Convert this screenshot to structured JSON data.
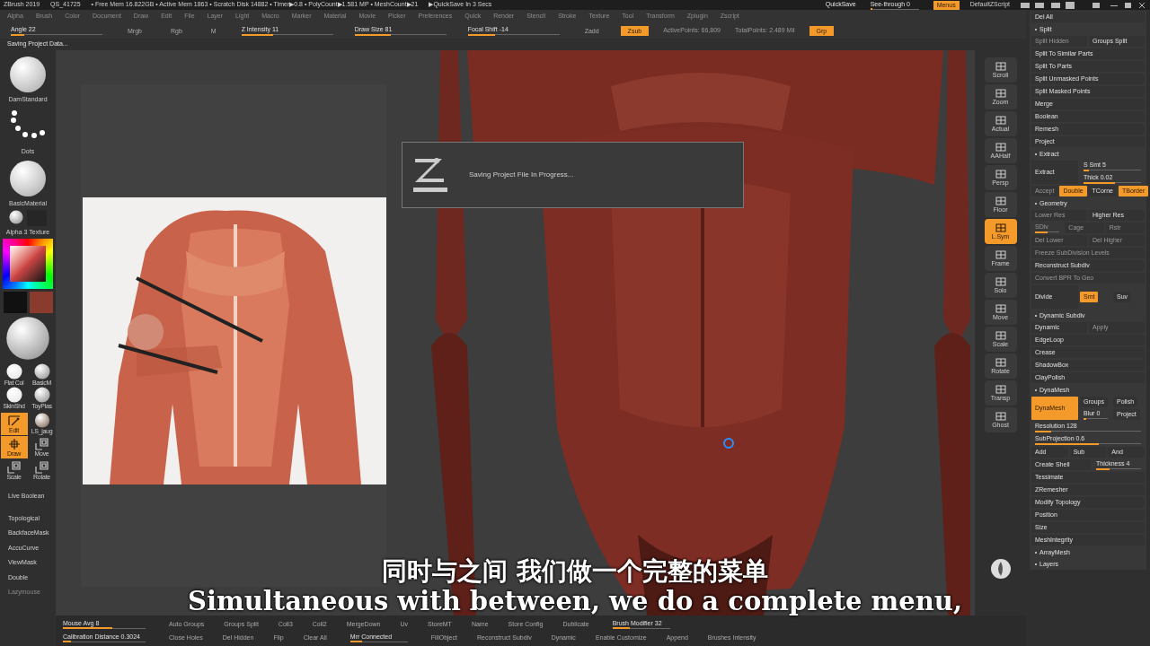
{
  "title_bar": {
    "app": "ZBrush 2019",
    "file": "QS_41725",
    "stats": "• Free Mem 16.822GB • Active Mem 1863 • Scratch Disk 14882 • Timer▶0.8 • PolyCount▶1.581 MP • MeshCount▶21",
    "quicksave_timer": "▶QuickSave In 3 Secs",
    "quicksave": "QuickSave",
    "see_through": {
      "label": "See-through  0",
      "level": 0.05
    },
    "menus": {
      "label": "Menus",
      "selected": true
    },
    "script": "DefaultZScript"
  },
  "menu_bar": [
    "Alpha",
    "Brush",
    "Color",
    "Document",
    "Draw",
    "Edit",
    "File",
    "Layer",
    "Light",
    "Macro",
    "Marker",
    "Material",
    "Movie",
    "Picker",
    "Preferences",
    "Quick",
    "Render",
    "Stencil",
    "Stroke",
    "Texture",
    "Tool",
    "Transform",
    "Zplugin",
    "Zscript"
  ],
  "toolbar": [
    {
      "kind": "slider",
      "label": "Angle 22",
      "level": 0.15
    },
    {
      "kind": "button",
      "label": "Mrgb",
      "highlighted": false
    },
    {
      "kind": "button",
      "label": "Rgb",
      "highlighted": false
    },
    {
      "kind": "button",
      "label": "M",
      "highlighted": false
    },
    {
      "kind": "slider",
      "label": "Z Intensity 11",
      "level": 0.35
    },
    {
      "kind": "slider",
      "label": "Draw Size 81",
      "level": 0.4
    },
    {
      "kind": "slider",
      "label": "Focal Shift -14",
      "level": 0.3
    },
    {
      "kind": "button",
      "label": "Zadd",
      "highlighted": false
    },
    {
      "kind": "button",
      "label": "Zsub",
      "highlighted": true
    },
    {
      "kind": "text",
      "label": "ActivePoints: 66,809"
    },
    {
      "kind": "text",
      "label": "TotalPoints: 2.489 Mil"
    },
    {
      "kind": "button",
      "label": "Grp",
      "highlighted": true
    }
  ],
  "status": "Saving Project Data...",
  "left_shelf": {
    "thumbnails": [
      {
        "kind": "sphere",
        "label": "DamStandard"
      },
      {
        "kind": "dots",
        "label": "Dots"
      },
      {
        "kind": "sphere",
        "label": "BasicMaterial"
      }
    ],
    "alpha_texture": "Alpha 3 Texture",
    "materials": [
      {
        "kind": "flat",
        "label": "Flat Col"
      },
      {
        "kind": "matte",
        "label": "BasicM"
      },
      {
        "kind": "flat",
        "label": "SkinShd"
      },
      {
        "kind": "matte",
        "label": "ToyPlas"
      }
    ],
    "tools": [
      {
        "kind": "edit",
        "label": "Edit",
        "selected": true
      },
      {
        "kind": "mesh",
        "label": "LS_jaug",
        "selected": false
      },
      {
        "kind": "draw",
        "label": "Draw",
        "selected": true
      },
      {
        "kind": "move",
        "label": "Move",
        "selected": false
      },
      {
        "kind": "move",
        "label": "Scale",
        "selected": false
      },
      {
        "kind": "rotate",
        "label": "Rotate",
        "selected": false
      }
    ],
    "buttons": [
      {
        "label": "Live Boolean",
        "disabled": false
      },
      {
        "label": "Topological",
        "disabled": false
      },
      {
        "label": "BackfaceMask",
        "disabled": false
      },
      {
        "label": "AccuCurve",
        "disabled": false
      },
      {
        "label": "ViewMask",
        "disabled": false
      },
      {
        "label": "Double",
        "disabled": false
      },
      {
        "label": "Lazymouse",
        "disabled": true
      }
    ]
  },
  "dialog": {
    "message": "Saving Project File In Progress..."
  },
  "subtitles": {
    "chinese": "同时与之间 我们做一个完整的菜单",
    "english": "Simultaneous with between, we do a complete menu,"
  },
  "right_toolbar": [
    {
      "label": "Scroll",
      "selected": false
    },
    {
      "label": "Zoom",
      "selected": false
    },
    {
      "label": "Actual",
      "selected": false
    },
    {
      "label": "AAHalf",
      "selected": false
    },
    {
      "label": "Persp",
      "selected": false
    },
    {
      "label": "Floor",
      "selected": false
    },
    {
      "label": "L.Sym",
      "selected": true
    },
    {
      "label": "Frame",
      "selected": false
    },
    {
      "label": "Solo",
      "selected": false
    },
    {
      "label": "Move",
      "selected": false
    },
    {
      "label": "Scale",
      "selected": false
    },
    {
      "label": "Rotate",
      "selected": false
    },
    {
      "label": "Transp",
      "selected": false
    },
    {
      "label": "Ghost",
      "selected": false
    }
  ],
  "tool_panel": [
    {
      "kind": "row",
      "cells": [
        {
          "kind": "button",
          "label": "Del All",
          "highlighted": false,
          "disabled": false
        }
      ]
    },
    {
      "kind": "section",
      "label": "Split"
    },
    {
      "kind": "row",
      "cells": [
        {
          "kind": "button",
          "label": "Split Hidden",
          "highlighted": false,
          "disabled": true
        },
        {
          "kind": "button",
          "label": "Groups Split",
          "highlighted": false,
          "disabled": false
        }
      ]
    },
    {
      "kind": "row",
      "cells": [
        {
          "kind": "button",
          "label": "Split To Similar Parts",
          "highlighted": false,
          "disabled": false
        }
      ]
    },
    {
      "kind": "row",
      "cells": [
        {
          "kind": "button",
          "label": "Split To Parts",
          "highlighted": false,
          "disabled": false
        }
      ]
    },
    {
      "kind": "row",
      "cells": [
        {
          "kind": "button",
          "label": "Split Unmasked Points",
          "highlighted": false,
          "disabled": false
        }
      ]
    },
    {
      "kind": "row",
      "cells": [
        {
          "kind": "button",
          "label": "Split Masked Points",
          "highlighted": false,
          "disabled": false
        }
      ]
    },
    {
      "kind": "row",
      "cells": [
        {
          "kind": "button",
          "label": "Merge",
          "highlighted": false,
          "disabled": false
        }
      ]
    },
    {
      "kind": "row",
      "cells": [
        {
          "kind": "button",
          "label": "Boolean",
          "highlighted": false,
          "disabled": false
        }
      ]
    },
    {
      "kind": "row",
      "cells": [
        {
          "kind": "button",
          "label": "Remesh",
          "highlighted": false,
          "disabled": false
        }
      ]
    },
    {
      "kind": "row",
      "cells": [
        {
          "kind": "button",
          "label": "Project",
          "highlighted": false,
          "disabled": false
        }
      ]
    },
    {
      "kind": "section",
      "label": "Extract"
    },
    {
      "kind": "block",
      "main": {
        "kind": "button",
        "label": "Extract",
        "highlighted": false,
        "disabled": false
      },
      "side": [
        {
          "kind": "slider",
          "label": "S Smt 5",
          "level": 0.1,
          "disabled": false
        },
        {
          "kind": "slider",
          "label": "Thick 0.02",
          "level": 0.55,
          "disabled": false
        }
      ]
    },
    {
      "kind": "row",
      "cells": [
        {
          "kind": "button",
          "label": "Accept",
          "highlighted": false,
          "disabled": true
        },
        {
          "kind": "button",
          "label": "Double",
          "highlighted": true,
          "disabled": false
        },
        {
          "kind": "button",
          "label": "TCorne",
          "highlighted": false,
          "disabled": false
        },
        {
          "kind": "button",
          "label": "TBorder",
          "highlighted": true,
          "disabled": false
        }
      ]
    },
    {
      "kind": "section",
      "label": "Geometry"
    },
    {
      "kind": "row",
      "cells": [
        {
          "kind": "button",
          "label": "Lower Res",
          "highlighted": false,
          "disabled": true
        },
        {
          "kind": "button",
          "label": "Higher Res",
          "highlighted": false,
          "disabled": false
        }
      ]
    },
    {
      "kind": "row",
      "cells": [
        {
          "kind": "slider",
          "label": "SDiv",
          "level": 0.5,
          "disabled": true
        },
        {
          "kind": "button",
          "label": "Cage",
          "highlighted": false,
          "disabled": true
        },
        {
          "kind": "button",
          "label": "Rstr",
          "highlighted": false,
          "disabled": true
        }
      ]
    },
    {
      "kind": "row",
      "cells": [
        {
          "kind": "button",
          "label": "Del Lower",
          "highlighted": false,
          "disabled": true
        },
        {
          "kind": "button",
          "label": "Del Higher",
          "highlighted": false,
          "disabled": true
        }
      ]
    },
    {
      "kind": "row",
      "cells": [
        {
          "kind": "button",
          "label": "Freeze SubDivision Levels",
          "highlighted": false,
          "disabled": true
        }
      ]
    },
    {
      "kind": "row",
      "cells": [
        {
          "kind": "button",
          "label": "Reconstruct Subdiv",
          "highlighted": false,
          "disabled": false
        }
      ]
    },
    {
      "kind": "row",
      "cells": [
        {
          "kind": "button",
          "label": "Convert BPR To Geo",
          "highlighted": false,
          "disabled": true
        }
      ]
    },
    {
      "kind": "block",
      "main": {
        "kind": "button",
        "label": "Divide",
        "highlighted": false,
        "disabled": false
      },
      "side": [
        {
          "kind": "button",
          "label": "Smt",
          "highlighted": true,
          "disabled": false
        },
        {
          "kind": "button",
          "label": "Suv",
          "highlighted": false,
          "disabled": false
        }
      ]
    },
    {
      "kind": "section",
      "label": "Dynamic Subdiv"
    },
    {
      "kind": "row",
      "cells": [
        {
          "kind": "button",
          "label": "Dynamic",
          "highlighted": false,
          "disabled": false
        },
        {
          "kind": "button",
          "label": "Apply",
          "highlighted": false,
          "disabled": true
        }
      ]
    },
    {
      "kind": "row",
      "cells": [
        {
          "kind": "button",
          "label": "EdgeLoop",
          "highlighted": false,
          "disabled": false
        }
      ]
    },
    {
      "kind": "row",
      "cells": [
        {
          "kind": "button",
          "label": "Crease",
          "highlighted": false,
          "disabled": false
        }
      ]
    },
    {
      "kind": "row",
      "cells": [
        {
          "kind": "button",
          "label": "ShadowBox",
          "highlighted": false,
          "disabled": false
        }
      ]
    },
    {
      "kind": "row",
      "cells": [
        {
          "kind": "button",
          "label": "ClayPolish",
          "highlighted": false,
          "disabled": false
        }
      ]
    },
    {
      "kind": "section",
      "label": "DynaMesh"
    },
    {
      "kind": "block",
      "main": {
        "kind": "button",
        "label": "DynaMesh",
        "highlighted": true,
        "disabled": false
      },
      "side": [
        {
          "kind": "button",
          "label": "Groups",
          "highlighted": false,
          "disabled": false
        },
        {
          "kind": "button",
          "label": "Polish",
          "highlighted": false,
          "disabled": false
        },
        {
          "kind": "slider",
          "label": "Blur 0",
          "level": 0.1,
          "disabled": false
        },
        {
          "kind": "button",
          "label": "Project",
          "highlighted": false,
          "disabled": false
        }
      ]
    },
    {
      "kind": "row",
      "cells": [
        {
          "kind": "slider",
          "label": "Resolution 128",
          "level": 0.15,
          "disabled": false
        }
      ]
    },
    {
      "kind": "row",
      "cells": [
        {
          "kind": "slider",
          "label": "SubProjection 0.6",
          "level": 0.6,
          "disabled": false
        }
      ]
    },
    {
      "kind": "row",
      "cells": [
        {
          "kind": "button",
          "label": "Add",
          "highlighted": false,
          "disabled": false
        },
        {
          "kind": "button",
          "label": "Sub",
          "highlighted": false,
          "disabled": false
        },
        {
          "kind": "button",
          "label": "And",
          "highlighted": false,
          "disabled": false
        }
      ]
    },
    {
      "kind": "row",
      "cells": [
        {
          "kind": "button",
          "label": "Create Shell",
          "highlighted": false,
          "disabled": false
        },
        {
          "kind": "slider",
          "label": "Thickness 4",
          "level": 0.3,
          "disabled": false
        }
      ]
    },
    {
      "kind": "row",
      "cells": [
        {
          "kind": "button",
          "label": "Tessimate",
          "highlighted": false,
          "disabled": false
        }
      ]
    },
    {
      "kind": "row",
      "cells": [
        {
          "kind": "button",
          "label": "ZRemesher",
          "highlighted": false,
          "disabled": false
        }
      ]
    },
    {
      "kind": "row",
      "cells": [
        {
          "kind": "button",
          "label": "Modify Topology",
          "highlighted": false,
          "disabled": false
        }
      ]
    },
    {
      "kind": "row",
      "cells": [
        {
          "kind": "button",
          "label": "Position",
          "highlighted": false,
          "disabled": false
        }
      ]
    },
    {
      "kind": "row",
      "cells": [
        {
          "kind": "button",
          "label": "Size",
          "highlighted": false,
          "disabled": false
        }
      ]
    },
    {
      "kind": "row",
      "cells": [
        {
          "kind": "button",
          "label": "MeshIntegrity",
          "highlighted": false,
          "disabled": false
        }
      ]
    },
    {
      "kind": "section",
      "label": "ArrayMesh"
    },
    {
      "kind": "section",
      "label": "Layers"
    }
  ],
  "bottom_bar": [
    [
      {
        "kind": "slider",
        "label": "Mouse Avg 8",
        "level": 0.6
      },
      {
        "kind": "button",
        "label": "Auto Groups"
      },
      {
        "kind": "button",
        "label": "Groups Split"
      },
      {
        "kind": "button",
        "label": "Coll3"
      },
      {
        "kind": "button",
        "label": "Coll2"
      },
      {
        "kind": "button",
        "label": "MergeDown"
      },
      {
        "kind": "button",
        "label": "Uv"
      },
      {
        "kind": "button",
        "label": "StoreMT"
      },
      {
        "kind": "button",
        "label": "Name"
      },
      {
        "kind": "button",
        "label": "Store Config"
      },
      {
        "kind": "button",
        "label": "Dublicate"
      },
      {
        "kind": "slider",
        "label": "Brush Modifier 32",
        "level": 0.3
      }
    ],
    [
      {
        "kind": "slider",
        "label": "Calibration Distance 0.3024",
        "level": 0.1
      },
      {
        "kind": "button",
        "label": "Close Holes"
      },
      {
        "kind": "button",
        "label": "Del Hidden"
      },
      {
        "kind": "button",
        "label": "Flip"
      },
      {
        "kind": "button",
        "label": "Clear All"
      },
      {
        "kind": "slider",
        "label": "Mrr Connected",
        "level": 0.2
      },
      {
        "kind": "button",
        "label": "FillObject"
      },
      {
        "kind": "button",
        "label": "Reconstruct Subdiv"
      },
      {
        "kind": "button",
        "label": "Dynamic"
      },
      {
        "kind": "button",
        "label": "Enable Customize"
      },
      {
        "kind": "button",
        "label": "Append"
      },
      {
        "kind": "button",
        "label": "Brushes Intensity"
      }
    ]
  ]
}
